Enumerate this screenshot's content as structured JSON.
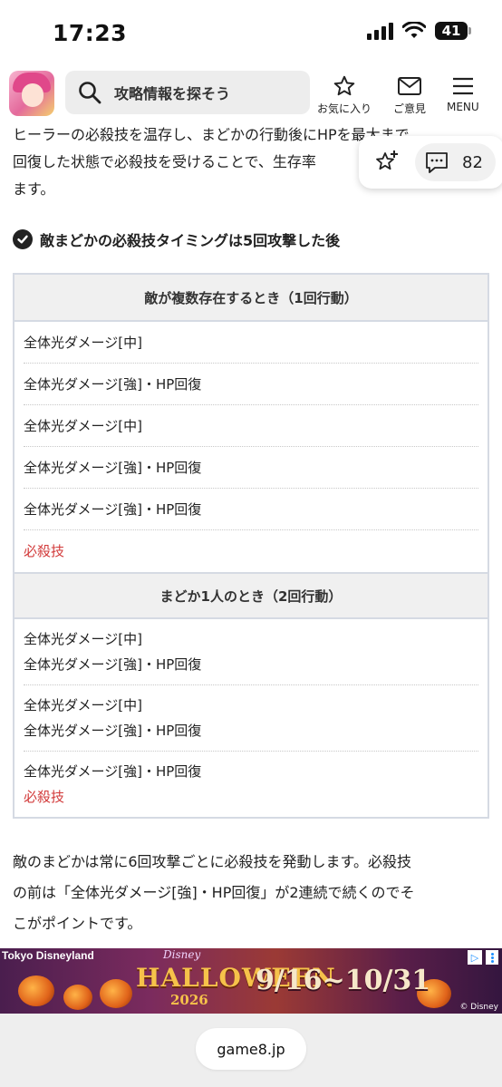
{
  "status_bar": {
    "time": "17:23",
    "battery": "41"
  },
  "header": {
    "search_placeholder": "攻略情報を探そう",
    "favorites_label": "お気に入り",
    "feedback_label": "ご意見",
    "menu_label": "MENU"
  },
  "floating": {
    "comment_count": "82"
  },
  "intro_lines": [
    "ヒーラーの必殺技を温存し、まどかの行動後にHPを最大まで",
    "回復した状態で必殺技を受けることで、生存率",
    "ます。"
  ],
  "section_heading": "敵まどかの必殺技タイミングは5回攻撃した後",
  "table": {
    "section1": {
      "header": "敵が複数存在するとき（1回行動）",
      "rows": [
        "全体光ダメージ[中]",
        "全体光ダメージ[強]・HP回復",
        "全体光ダメージ[中]",
        "全体光ダメージ[強]・HP回復",
        "全体光ダメージ[強]・HP回復",
        "必殺技"
      ]
    },
    "section2": {
      "header": "まどか1人のとき（2回行動）",
      "rows": [
        [
          "全体光ダメージ[中]",
          "全体光ダメージ[強]・HP回復"
        ],
        [
          "全体光ダメージ[中]",
          "全体光ダメージ[強]・HP回復"
        ],
        [
          "全体光ダメージ[強]・HP回復",
          "必殺技"
        ]
      ]
    }
  },
  "outro_lines": [
    "敵のまどかは常に6回攻撃ごとに必殺技を発動します。必殺技",
    "の前は「全体光ダメージ[強]・HP回復」が2連続で続くのでそ",
    "こがポイントです。"
  ],
  "ad": {
    "brand": "Tokyo Disneyland",
    "disney": "Disney",
    "title": "HALLOWEEN",
    "year": "2026",
    "dates": "9/16~10/31",
    "copyright": "© Disney"
  },
  "browser": {
    "url": "game8.jp"
  },
  "colors": {
    "special_move": "#d23a3a",
    "table_border": "#d5dae3",
    "table_header_bg": "#f0f0f0"
  }
}
